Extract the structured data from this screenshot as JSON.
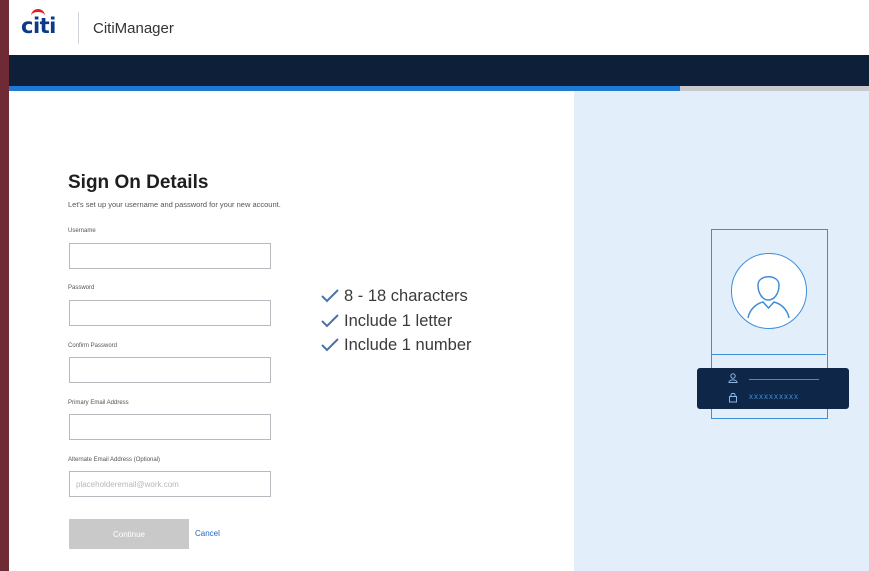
{
  "header": {
    "brand": "citi",
    "app_name": "CitiManager"
  },
  "progress": {
    "fraction": 0.78
  },
  "form": {
    "title": "Sign On Details",
    "subtitle": "Let's set up your username and password for your new account.",
    "fields": [
      {
        "label": "Username",
        "value": "",
        "placeholder": ""
      },
      {
        "label": "Password",
        "value": "",
        "placeholder": ""
      },
      {
        "label": "Confirm Password",
        "value": "",
        "placeholder": ""
      },
      {
        "label": "Primary Email Address",
        "value": "",
        "placeholder": ""
      },
      {
        "label": "Alternate Email Address (Optional)",
        "value": "",
        "placeholder": "placeholderemail@work.com"
      }
    ],
    "continue_label": "Continue",
    "cancel_label": "Cancel"
  },
  "requirements": [
    "8 - 18 characters",
    "Include 1 letter",
    "Include 1 number"
  ],
  "illustration": {
    "masked_password": "xxxxxxxxxx"
  },
  "colors": {
    "brand_blue": "#0b3a8c",
    "brand_red": "#e0201f",
    "nav_dark": "#0e1f3a",
    "accent": "#1f7ad6",
    "panel": "#e3eefb"
  }
}
